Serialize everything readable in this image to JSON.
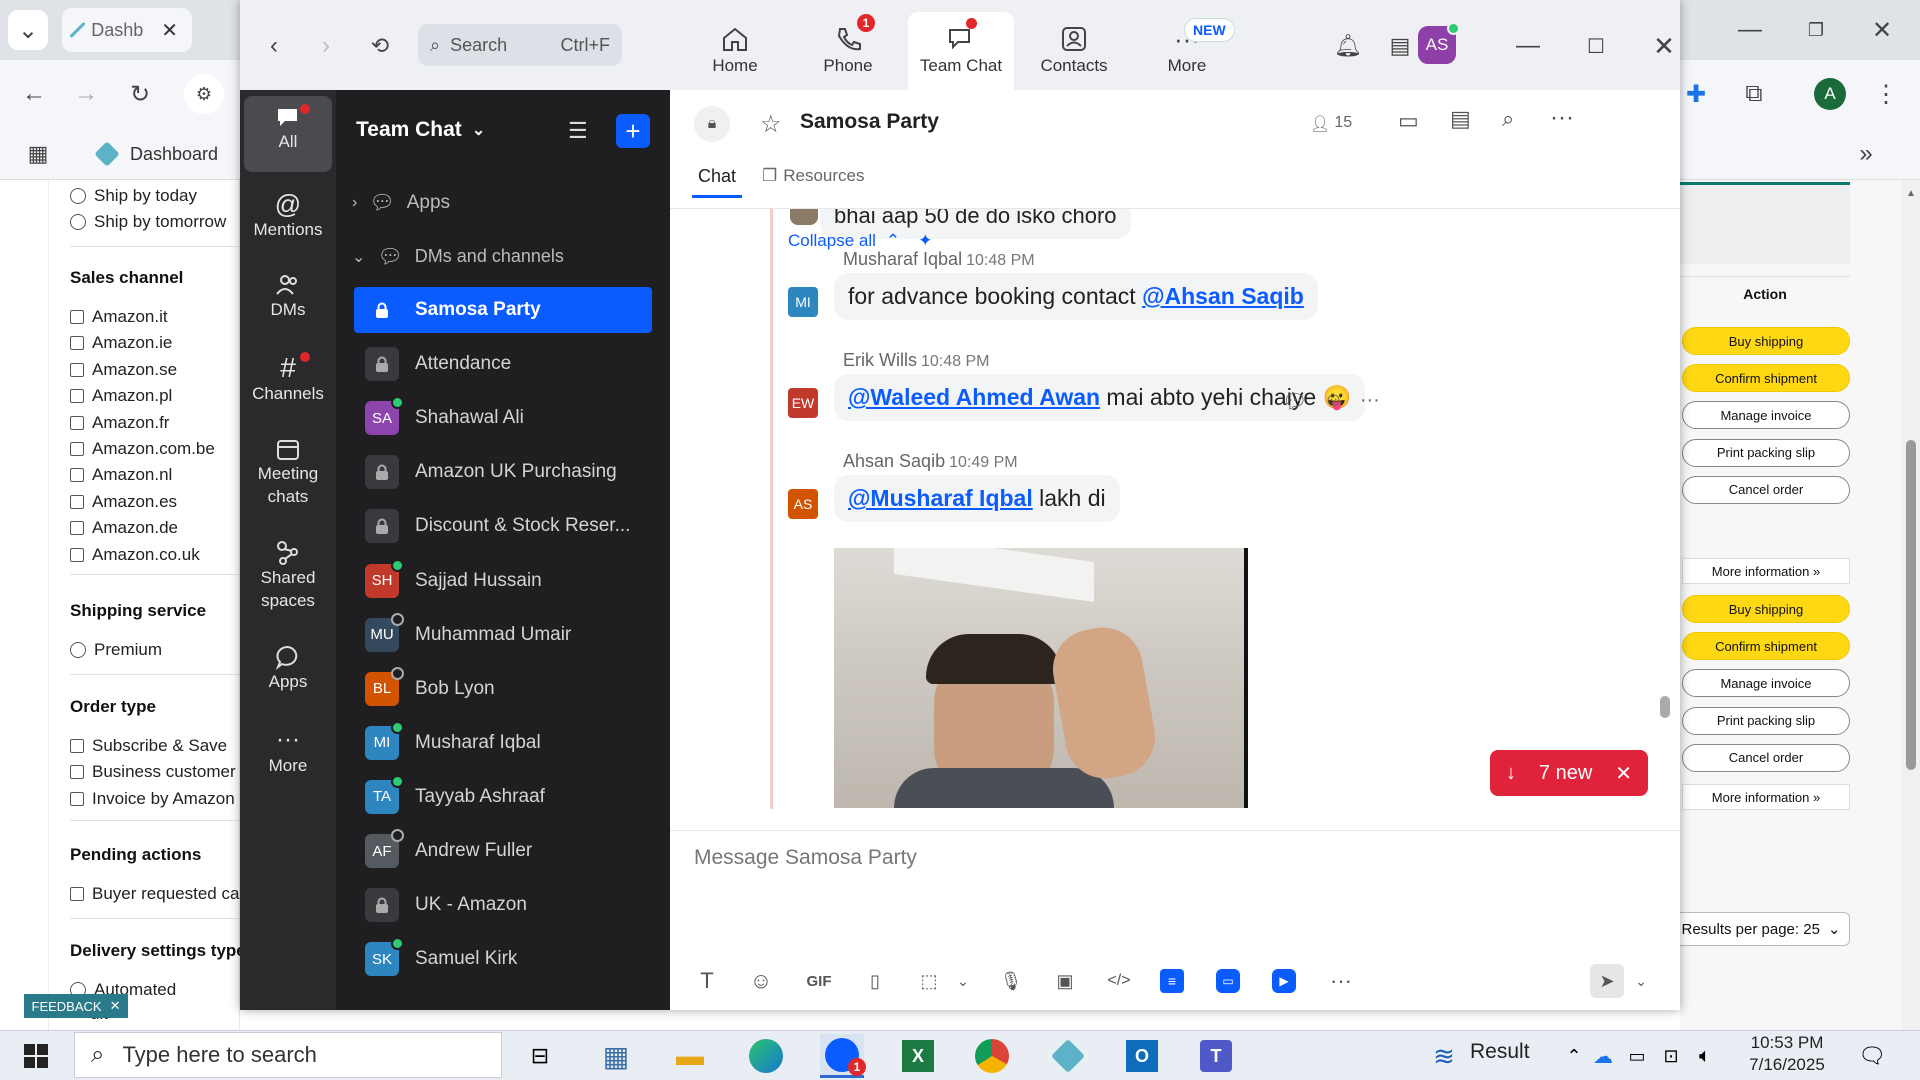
{
  "browser": {
    "tab_title": "Dashb",
    "bookmark_label": "Dashboard",
    "profile_letter": "A"
  },
  "filters": {
    "ship_today": "Ship by today",
    "ship_tomorrow": "Ship by tomorrow",
    "sales_channel_title": "Sales channel",
    "sales_channels": [
      "Amazon.it",
      "Amazon.ie",
      "Amazon.se",
      "Amazon.pl",
      "Amazon.fr",
      "Amazon.com.be",
      "Amazon.nl",
      "Amazon.es",
      "Amazon.de",
      "Amazon.co.uk"
    ],
    "shipping_service_title": "Shipping service",
    "premium": "Premium",
    "order_type_title": "Order type",
    "order_types": [
      "Subscribe & Save",
      "Business customer",
      "Invoice by Amazon"
    ],
    "pending_title": "Pending actions",
    "pending_item": "Buyer requested ca",
    "delivery_title": "Delivery settings type",
    "automated": "Automated",
    "truncated": "ult",
    "feedback": "FEEDBACK"
  },
  "right_panel": {
    "action_header": "Action",
    "buttons_group1": [
      "Buy shipping",
      "Confirm shipment",
      "Manage invoice",
      "Print packing slip",
      "Cancel order"
    ],
    "more_info_1": "More information »",
    "buttons_group2": [
      "Buy shipping",
      "Confirm shipment",
      "Manage invoice",
      "Print packing slip",
      "Cancel order"
    ],
    "more_info_2": "More information »",
    "results_per_page": "Results per page: 25"
  },
  "zoom": {
    "search_placeholder": "Search",
    "search_shortcut": "Ctrl+F",
    "nav": {
      "home": "Home",
      "phone": "Phone",
      "phone_badge": "1",
      "team_chat": "Team Chat",
      "contacts": "Contacts",
      "more": "More",
      "new_badge": "NEW"
    },
    "user_initials": "AS",
    "rail": {
      "all": "All",
      "mentions": "Mentions",
      "dms": "DMs",
      "channels": "Channels",
      "meeting_chats_1": "Meeting",
      "meeting_chats_2": "chats",
      "shared_spaces_1": "Shared",
      "shared_spaces_2": "spaces",
      "apps": "Apps",
      "more": "More"
    },
    "list": {
      "title": "Team Chat",
      "apps": "Apps",
      "dms_channels": "DMs and channels",
      "items": [
        {
          "name": "Samosa Party",
          "type": "lock",
          "active": true
        },
        {
          "name": "Attendance",
          "type": "lock"
        },
        {
          "name": "Shahawal Ali",
          "initials": "SA",
          "color": "#8e44ad",
          "status": "on"
        },
        {
          "name": "Amazon UK Purchasing",
          "type": "lock"
        },
        {
          "name": "Discount & Stock Reser...",
          "type": "lock"
        },
        {
          "name": "Sajjad Hussain",
          "initials": "SH",
          "color": "#c0392b",
          "status": "on"
        },
        {
          "name": "Muhammad Umair",
          "initials": "MU",
          "color": "#34495e",
          "status": "off"
        },
        {
          "name": "Bob Lyon",
          "initials": "BL",
          "color": "#d35400",
          "status": "off"
        },
        {
          "name": "Musharaf Iqbal",
          "initials": "MI",
          "color": "#2e86c1",
          "status": "on"
        },
        {
          "name": "Tayyab Ashraaf",
          "initials": "TA",
          "color": "#2e86c1",
          "status": "on"
        },
        {
          "name": "Andrew Fuller",
          "initials": "AF",
          "color": "#555a60",
          "status": "off"
        },
        {
          "name": "UK - Amazon",
          "type": "lock"
        },
        {
          "name": "Samuel Kirk",
          "initials": "SK",
          "color": "#2e86c1",
          "status": "on"
        }
      ]
    },
    "chat": {
      "title": "Samosa Party",
      "members": "15",
      "tab_chat": "Chat",
      "tab_resources": "Resources",
      "prev_msg": "bhai aap 50 de do isko choro",
      "collapse": "Collapse all",
      "messages": [
        {
          "author": "Musharaf Iqbal",
          "time": "10:48 PM",
          "initials": "MI",
          "color": "#2e86c1",
          "text": "for advance booking contact ",
          "mention": "@Ahsan Saqib"
        },
        {
          "author": "Erik Wills",
          "time": "10:48 PM",
          "initials": "EW",
          "color": "#c0392b",
          "mention": "@Waleed Ahmed Awan",
          "text": " mai abto yehi chaiye 😛"
        },
        {
          "author": "Ahsan Saqib",
          "time": "10:49 PM",
          "initials": "AS",
          "color": "#d35400",
          "mention": "@Musharaf Iqbal",
          "text": " lakh di"
        }
      ],
      "new_count": "7 new",
      "composer_placeholder": "Message Samosa Party"
    }
  },
  "taskbar": {
    "search_placeholder": "Type here to search",
    "zoom_badge": "1",
    "weather": "Result",
    "time": "10:53 PM",
    "date": "7/16/2025"
  }
}
